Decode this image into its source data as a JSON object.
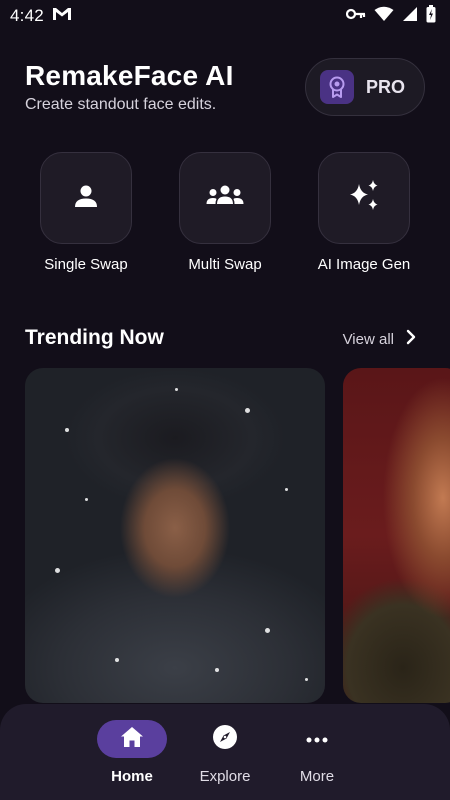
{
  "status_bar": {
    "time": "4:42",
    "icons": [
      "gmail-icon",
      "vpn-key-icon",
      "wifi-icon",
      "signal-icon",
      "battery-icon"
    ]
  },
  "header": {
    "title": "RemakeFace AI",
    "subtitle": "Create standout face edits.",
    "pro_label": "PRO"
  },
  "actions": [
    {
      "label": "Single Swap",
      "icon": "person-icon"
    },
    {
      "label": "Multi Swap",
      "icon": "group-icon"
    },
    {
      "label": "AI Image Gen",
      "icon": "sparkles-icon"
    }
  ],
  "trending": {
    "title": "Trending Now",
    "view_all": "View all"
  },
  "bottom_nav": {
    "items": [
      {
        "label": "Home",
        "icon": "home-icon",
        "active": true
      },
      {
        "label": "Explore",
        "icon": "compass-icon",
        "active": false
      },
      {
        "label": "More",
        "icon": "more-horizontal-icon",
        "active": false
      }
    ]
  },
  "colors": {
    "background": "#120e19",
    "accent": "#5a3f9e",
    "tile": "#1f1b26",
    "nav_bar": "#201b2b"
  }
}
